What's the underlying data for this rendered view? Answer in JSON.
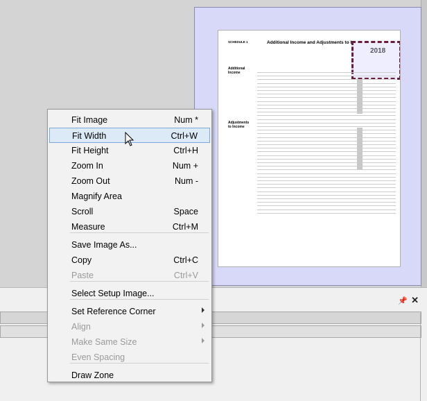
{
  "document": {
    "schedule": "SCHEDULE 1",
    "title": "Additional Income and Adjustments to Income",
    "year": "2018"
  },
  "context_menu": {
    "items": [
      {
        "label": "Fit Image",
        "shortcut": "Num *",
        "enabled": true,
        "selected": false
      },
      {
        "label": "Fit Width",
        "shortcut": "Ctrl+W",
        "enabled": true,
        "selected": true
      },
      {
        "label": "Fit Height",
        "shortcut": "Ctrl+H",
        "enabled": true,
        "selected": false
      },
      {
        "label": "Zoom In",
        "shortcut": "Num +",
        "enabled": true,
        "selected": false
      },
      {
        "label": "Zoom Out",
        "shortcut": "Num -",
        "enabled": true,
        "selected": false
      },
      {
        "label": "Magnify Area",
        "shortcut": "",
        "enabled": true,
        "selected": false
      },
      {
        "label": "Scroll",
        "shortcut": "Space",
        "enabled": true,
        "selected": false
      },
      {
        "label": "Measure",
        "shortcut": "Ctrl+M",
        "enabled": true,
        "selected": false
      },
      {
        "label": "Save Image As...",
        "shortcut": "",
        "enabled": true,
        "selected": false
      },
      {
        "label": "Copy",
        "shortcut": "Ctrl+C",
        "enabled": true,
        "selected": false
      },
      {
        "label": "Paste",
        "shortcut": "Ctrl+V",
        "enabled": false,
        "selected": false
      },
      {
        "label": "Select Setup Image...",
        "shortcut": "",
        "enabled": true,
        "selected": false
      },
      {
        "label": "Set Reference Corner",
        "shortcut": "",
        "enabled": true,
        "submenu": true
      },
      {
        "label": "Align",
        "shortcut": "",
        "enabled": false,
        "submenu": true
      },
      {
        "label": "Make Same Size",
        "shortcut": "",
        "enabled": false,
        "submenu": true
      },
      {
        "label": "Even Spacing",
        "shortcut": "",
        "enabled": false
      },
      {
        "label": "Draw Zone",
        "shortcut": "",
        "enabled": true
      }
    ]
  },
  "panel": {
    "pin_icon": "pin-icon",
    "close_icon": "close-icon"
  }
}
